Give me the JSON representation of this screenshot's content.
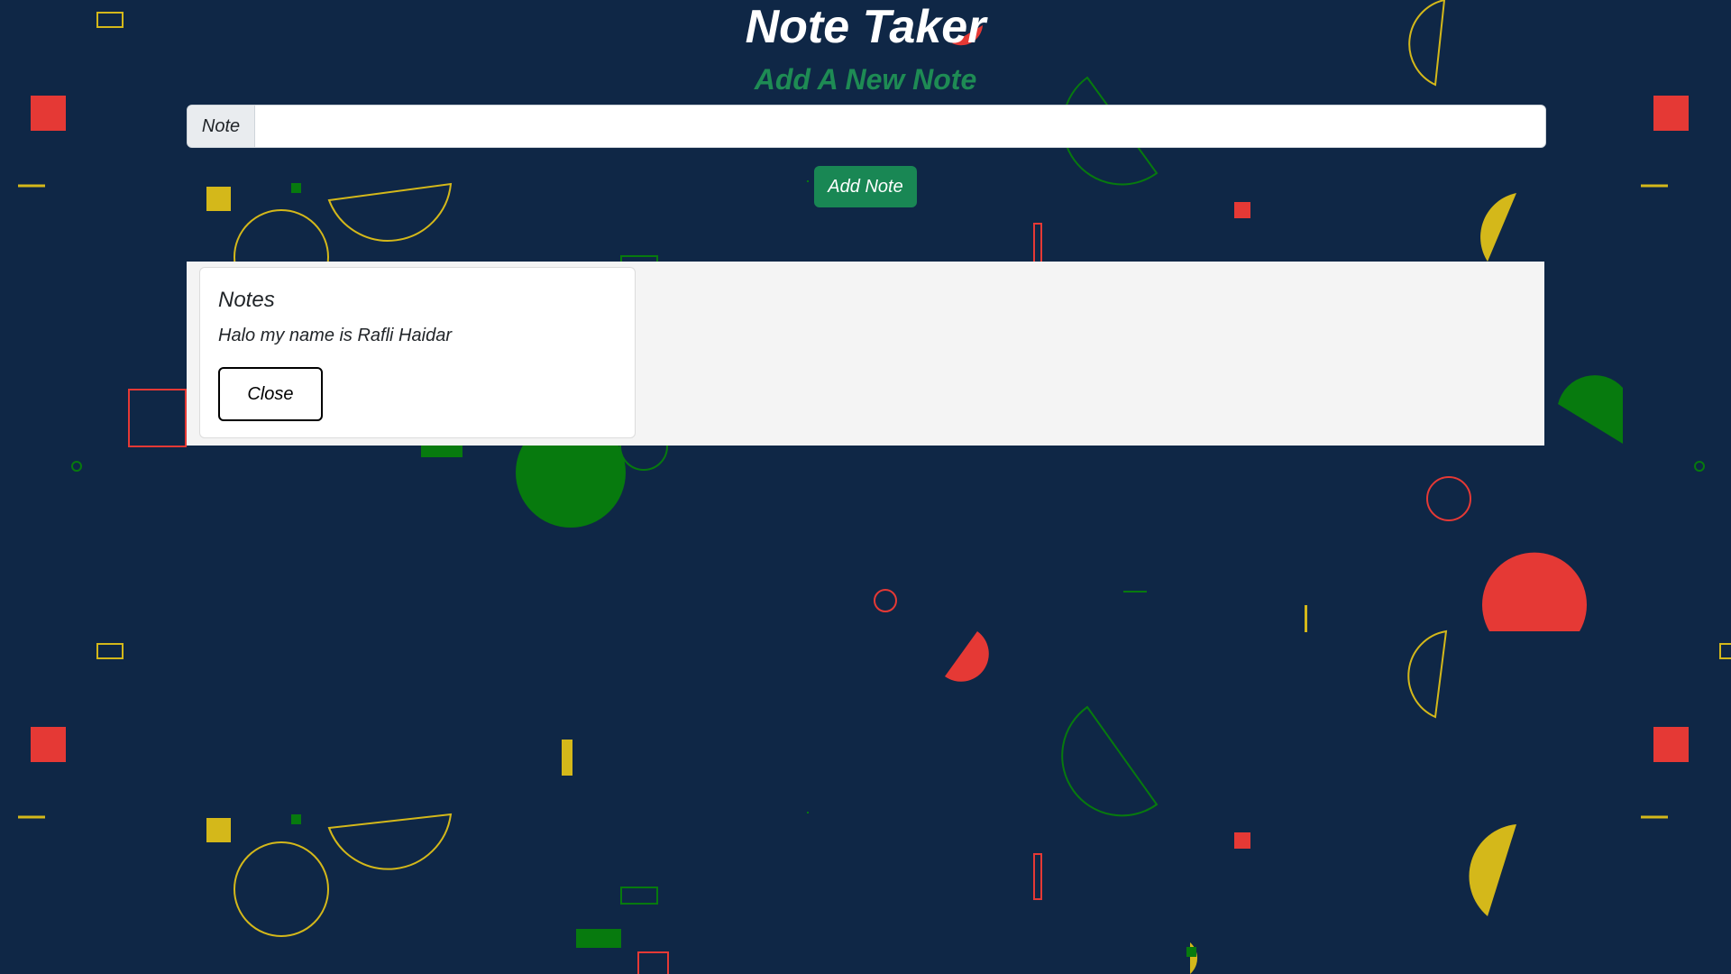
{
  "header": {
    "title": "Note Taker",
    "subtitle": "Add A New Note"
  },
  "form": {
    "prefix_label": "Note",
    "input_value": "",
    "input_placeholder": "",
    "add_button_label": "Add Note"
  },
  "notes": [
    {
      "title": "Notes",
      "text": "Halo my name is Rafli Haidar",
      "close_label": "Close"
    }
  ],
  "colors": {
    "background": "#0f2746",
    "accent_green": "#198754",
    "subtitle_green": "#1e8b54",
    "shape_red": "#e53935",
    "shape_yellow": "#d4b81a",
    "shape_green": "#077a0e",
    "panel": "#f4f4f4"
  }
}
